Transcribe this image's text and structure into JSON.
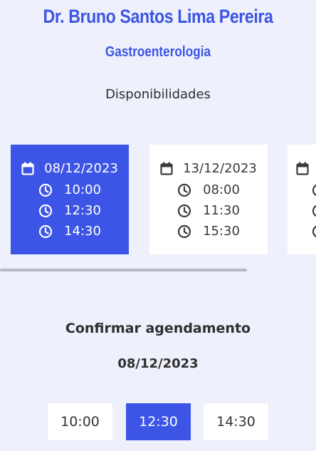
{
  "doctor": {
    "name": "Dr. Bruno Santos Lima Pereira",
    "specialty": "Gastroenterologia"
  },
  "availability": {
    "title": "Disponibilidades",
    "cards": [
      {
        "date": "08/12/2023",
        "times": [
          "10:00",
          "12:30",
          "14:30"
        ],
        "selected": true
      },
      {
        "date": "13/12/2023",
        "times": [
          "08:00",
          "11:30",
          "15:30"
        ],
        "selected": false
      },
      {
        "date": "",
        "times": [
          "",
          "",
          ""
        ],
        "selected": false
      }
    ]
  },
  "confirm": {
    "title": "Confirmar agendamento",
    "date": "08/12/2023",
    "slots": [
      "10:00",
      "12:30",
      "14:30"
    ],
    "selected_slot": "12:30"
  },
  "colors": {
    "accent": "#3c55e6",
    "background": "#eef0fb",
    "card": "#ffffff"
  },
  "icons": {
    "date": "calendar-icon",
    "time": "clock-icon"
  }
}
